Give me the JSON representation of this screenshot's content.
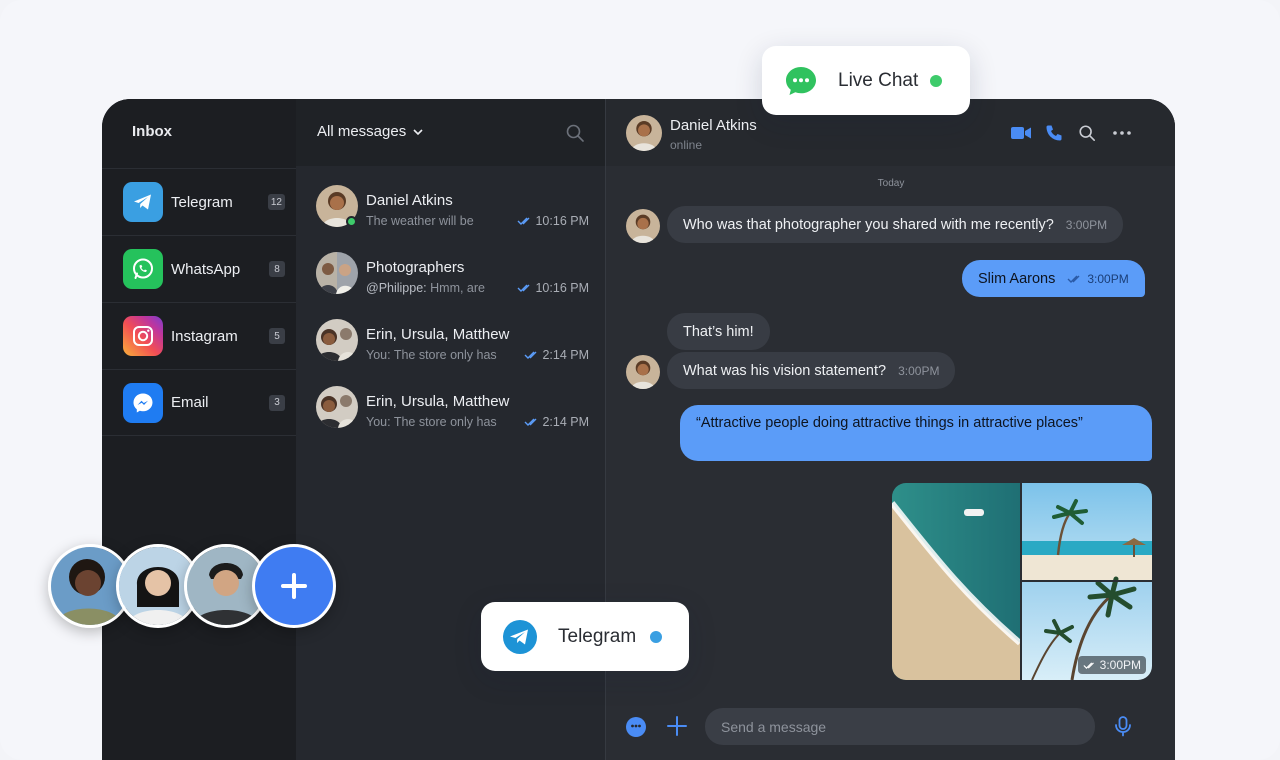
{
  "colors": {
    "accent": "#3f7cf2",
    "online": "#3ecb6b",
    "out_bubble": "#5b9cf8",
    "telegram_dot": "#3a9fe2"
  },
  "sidebar": {
    "title": "Inbox",
    "items": [
      {
        "label": "Telegram",
        "count": "12",
        "icon": "telegram-icon"
      },
      {
        "label": "WhatsApp",
        "count": "8",
        "icon": "whatsapp-icon"
      },
      {
        "label": "Instagram",
        "count": "5",
        "icon": "instagram-icon"
      },
      {
        "label": "Email",
        "count": "3",
        "icon": "messenger-icon"
      }
    ]
  },
  "list": {
    "filter": "All messages",
    "conversations": [
      {
        "name": "Daniel Atkins",
        "sender": "",
        "preview": "The weather will be",
        "time": "10:16 PM",
        "online": true
      },
      {
        "name": "Photographers",
        "sender": "@Philippe:",
        "preview": "Hmm, are",
        "time": "10:16 PM",
        "online": false
      },
      {
        "name": "Erin, Ursula, Matthew",
        "sender": "",
        "preview": "You: The store only has",
        "time": "2:14 PM",
        "online": false
      },
      {
        "name": "Erin, Ursula, Matthew",
        "sender": "",
        "preview": "You: The store only has",
        "time": "2:14 PM",
        "online": false
      }
    ]
  },
  "chat": {
    "name": "Daniel Atkins",
    "status": "online",
    "day": "Today",
    "messages": [
      {
        "text": "Who was that photographer you shared with me recently?",
        "time": "3:00PM"
      },
      {
        "text": "Slim Aarons",
        "time": "3:00PM"
      },
      {
        "text": "That’s him!"
      },
      {
        "text": "What was his vision statement?",
        "time": "3:00PM"
      },
      {
        "text": "“Attractive people doing attractive things in attractive places”"
      }
    ],
    "photo_time": "3:00PM",
    "composer_placeholder": "Send a message"
  },
  "floating": {
    "live_chat": "Live Chat",
    "telegram": "Telegram"
  }
}
